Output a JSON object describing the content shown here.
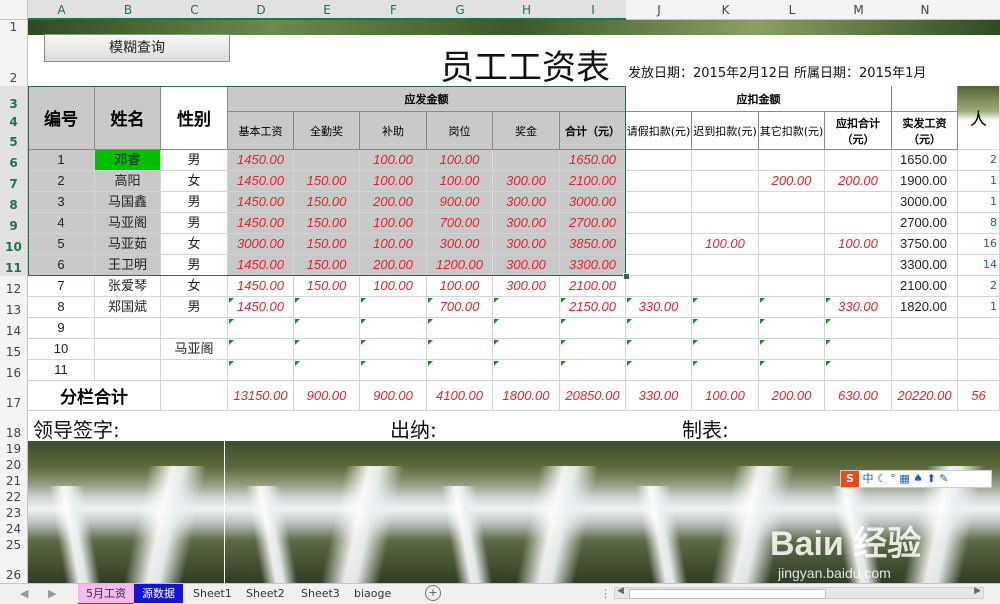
{
  "columns": [
    "A",
    "B",
    "C",
    "D",
    "E",
    "F",
    "G",
    "H",
    "I",
    "J",
    "K",
    "L",
    "M",
    "N"
  ],
  "rows": [
    "1",
    "2",
    "3",
    "4",
    "5",
    "6",
    "7",
    "8",
    "9",
    "10",
    "11",
    "12",
    "13",
    "14",
    "15",
    "16",
    "17",
    "18",
    "19",
    "20",
    "21",
    "22",
    "23",
    "24",
    "25",
    "26"
  ],
  "fuzzy_button": "模糊查询",
  "title": "员工工资表",
  "issue_dates": "发放日期：2015年2月12日 所属日期：2015年1月",
  "headers": {
    "id": "编号",
    "name": "姓名",
    "gender": "性别",
    "payable_group": "应发金额",
    "deduct_group": "应扣金额",
    "payable": [
      "基本工资",
      "全勤奖",
      "补助",
      "岗位",
      "奖金",
      "合计（元）"
    ],
    "deduct": [
      "请假扣款(元)",
      "迟到扣款(元)",
      "其它扣款(元)"
    ],
    "deduct_total": "应扣合计（元）",
    "net": "实发工资（元）",
    "extra": "人"
  },
  "employees": [
    {
      "id": "1",
      "name": "邓睿",
      "gender": "男",
      "base": "1450.00",
      "attend": "",
      "allow": "100.00",
      "post": "100.00",
      "bonus": "",
      "total": "1650.00",
      "leave": "",
      "late": "",
      "other": "",
      "dsum": "",
      "net": "1650.00",
      "o": "2"
    },
    {
      "id": "2",
      "name": "高阳",
      "gender": "女",
      "base": "1450.00",
      "attend": "150.00",
      "allow": "100.00",
      "post": "100.00",
      "bonus": "300.00",
      "total": "2100.00",
      "leave": "",
      "late": "",
      "other": "200.00",
      "dsum": "200.00",
      "net": "1900.00",
      "o": "1"
    },
    {
      "id": "3",
      "name": "马国鑫",
      "gender": "男",
      "base": "1450.00",
      "attend": "150.00",
      "allow": "200.00",
      "post": "900.00",
      "bonus": "300.00",
      "total": "3000.00",
      "leave": "",
      "late": "",
      "other": "",
      "dsum": "",
      "net": "3000.00",
      "o": "1"
    },
    {
      "id": "4",
      "name": "马亚阁",
      "gender": "男",
      "base": "1450.00",
      "attend": "150.00",
      "allow": "100.00",
      "post": "700.00",
      "bonus": "300.00",
      "total": "2700.00",
      "leave": "",
      "late": "",
      "other": "",
      "dsum": "",
      "net": "2700.00",
      "o": "8"
    },
    {
      "id": "5",
      "name": "马亚茹",
      "gender": "女",
      "base": "3000.00",
      "attend": "150.00",
      "allow": "100.00",
      "post": "300.00",
      "bonus": "300.00",
      "total": "3850.00",
      "leave": "",
      "late": "100.00",
      "other": "",
      "dsum": "100.00",
      "net": "3750.00",
      "o": "16"
    },
    {
      "id": "6",
      "name": "王卫明",
      "gender": "男",
      "base": "1450.00",
      "attend": "150.00",
      "allow": "200.00",
      "post": "1200.00",
      "bonus": "300.00",
      "total": "3300.00",
      "leave": "",
      "late": "",
      "other": "",
      "dsum": "",
      "net": "3300.00",
      "o": "14"
    },
    {
      "id": "7",
      "name": "张爱琴",
      "gender": "女",
      "base": "1450.00",
      "attend": "150.00",
      "allow": "100.00",
      "post": "100.00",
      "bonus": "300.00",
      "total": "2100.00",
      "leave": "",
      "late": "",
      "other": "",
      "dsum": "",
      "net": "2100.00",
      "o": "2"
    },
    {
      "id": "8",
      "name": "郑国斌",
      "gender": "男",
      "base": "1450.00",
      "attend": "",
      "allow": "",
      "post": "700.00",
      "bonus": "",
      "total": "2150.00",
      "leave": "330.00",
      "late": "",
      "other": "",
      "dsum": "330.00",
      "net": "1820.00",
      "o": "1"
    },
    {
      "id": "9",
      "name": "",
      "gender": "",
      "base": "",
      "attend": "",
      "allow": "",
      "post": "",
      "bonus": "",
      "total": "",
      "leave": "",
      "late": "",
      "other": "",
      "dsum": "",
      "net": "",
      "o": ""
    },
    {
      "id": "10",
      "name": "",
      "gender": "马亚阁",
      "base": "",
      "attend": "",
      "allow": "",
      "post": "",
      "bonus": "",
      "total": "",
      "leave": "",
      "late": "",
      "other": "",
      "dsum": "",
      "net": "",
      "o": ""
    },
    {
      "id": "11",
      "name": "",
      "gender": "",
      "base": "",
      "attend": "",
      "allow": "",
      "post": "",
      "bonus": "",
      "total": "",
      "leave": "",
      "late": "",
      "other": "",
      "dsum": "",
      "net": "",
      "o": ""
    }
  ],
  "subtotal": {
    "label": "分栏合计",
    "base": "13150.00",
    "attend": "900.00",
    "allow": "900.00",
    "post": "4100.00",
    "bonus": "1800.00",
    "total": "20850.00",
    "leave": "330.00",
    "late": "100.00",
    "other": "200.00",
    "dsum": "630.00",
    "net": "20220.00",
    "o": "56"
  },
  "signatures": {
    "leader": "领导签字:",
    "cashier": "出纳:",
    "maker": "制表:"
  },
  "tabs": [
    "5月工资",
    "源数据",
    "Sheet1",
    "Sheet2",
    "Sheet3",
    "biaoge"
  ],
  "colors": {
    "selection": "#217346",
    "red": "#e0252b",
    "gray_fill": "#c9c9c9",
    "highlight": "#00c000"
  }
}
